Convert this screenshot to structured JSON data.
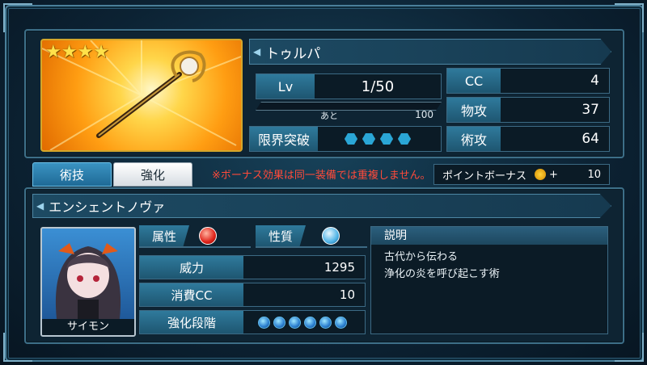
{
  "item": {
    "name": "トゥルパ",
    "stars": 4,
    "level_label": "Lv",
    "level_value": "1/50",
    "exp_prefix": "あと",
    "exp_remaining": "100",
    "limit_break_label": "限界突破",
    "stats": [
      {
        "label": "CC",
        "value": "4"
      },
      {
        "label": "物攻",
        "value": "37"
      },
      {
        "label": "術攻",
        "value": "64"
      }
    ]
  },
  "tabs": [
    {
      "label": "術技",
      "active": true
    },
    {
      "label": "強化",
      "active": false
    }
  ],
  "notice": "※ボーナス効果は同一装備では重複しません。",
  "point_bonus": {
    "label": "ポイントボーナス",
    "plus": "+",
    "value": "10"
  },
  "skill": {
    "name": "エンシェントノヴァ",
    "character_name": "サイモン",
    "attribute_label": "属性",
    "nature_label": "性質",
    "rows": [
      {
        "label": "威力",
        "value": "1295"
      },
      {
        "label": "消費CC",
        "value": "10"
      }
    ],
    "enhance_label": "強化段階",
    "enhance_gems": 6,
    "desc_title": "説明",
    "desc_line1": "古代から伝わる",
    "desc_line2": "浄化の炎を呼び起こす術"
  },
  "colors": {
    "accent": "#2f7a9c",
    "notice_red": "#ff4a3a",
    "gold": "#ffd23a"
  }
}
